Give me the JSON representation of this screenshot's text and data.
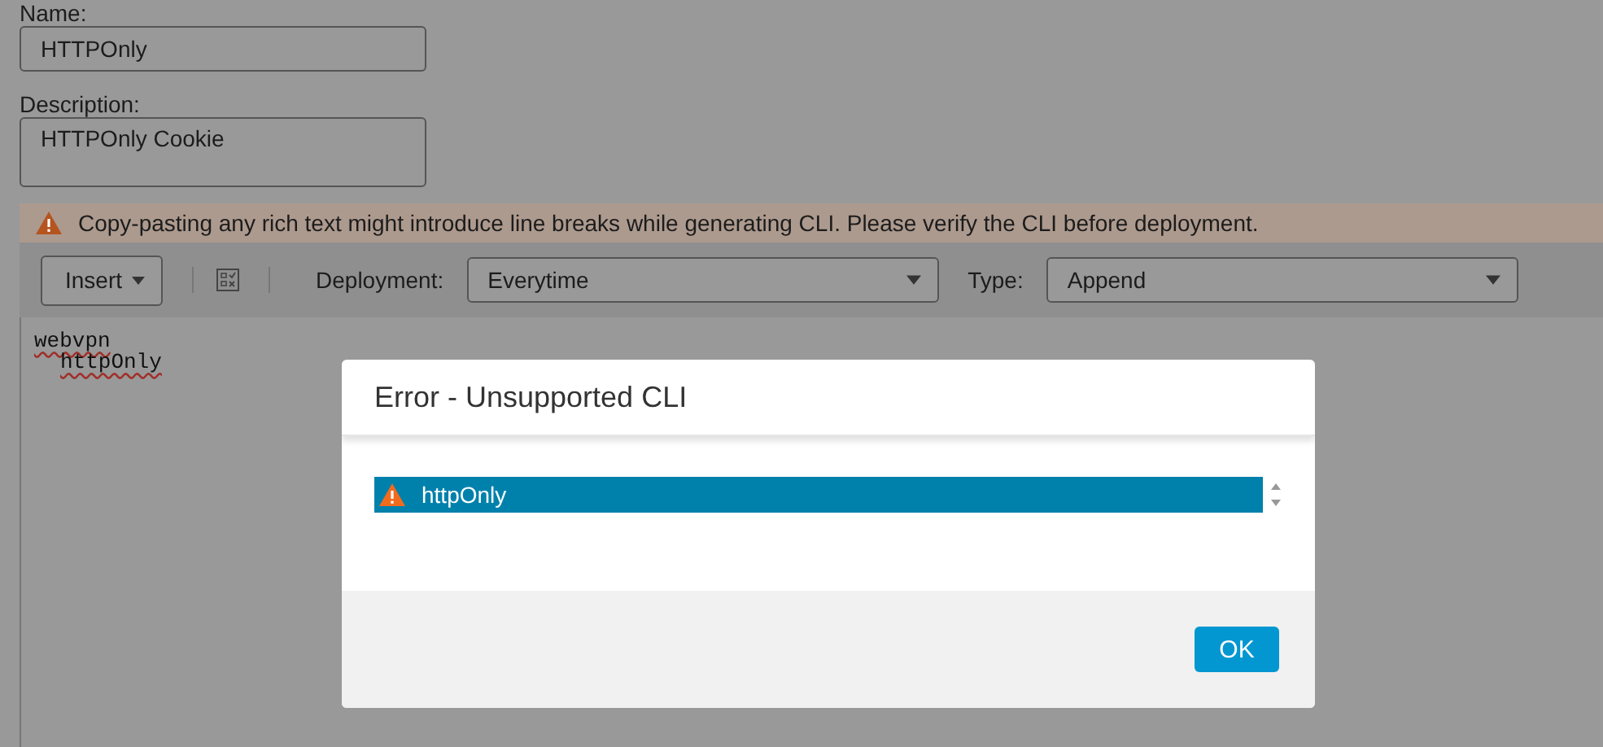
{
  "form": {
    "name_label": "Name:",
    "name_value": "HTTPOnly",
    "description_label": "Description:",
    "description_value": "HTTPOnly Cookie"
  },
  "warning": "Copy-pasting any rich text might introduce line breaks while generating CLI. Please verify the CLI before deployment.",
  "toolbar": {
    "insert": "Insert",
    "deployment_label": "Deployment:",
    "deployment_value": "Everytime",
    "type_label": "Type:",
    "type_value": "Append"
  },
  "editor_lines": [
    {
      "text": "webvpn",
      "children": [
        {
          "text": "httpOnly"
        }
      ]
    }
  ],
  "dialog": {
    "title": "Error - Unsupported CLI",
    "items": [
      {
        "text": "httpOnly",
        "selected": true
      }
    ],
    "buttons": [
      "OK"
    ]
  }
}
